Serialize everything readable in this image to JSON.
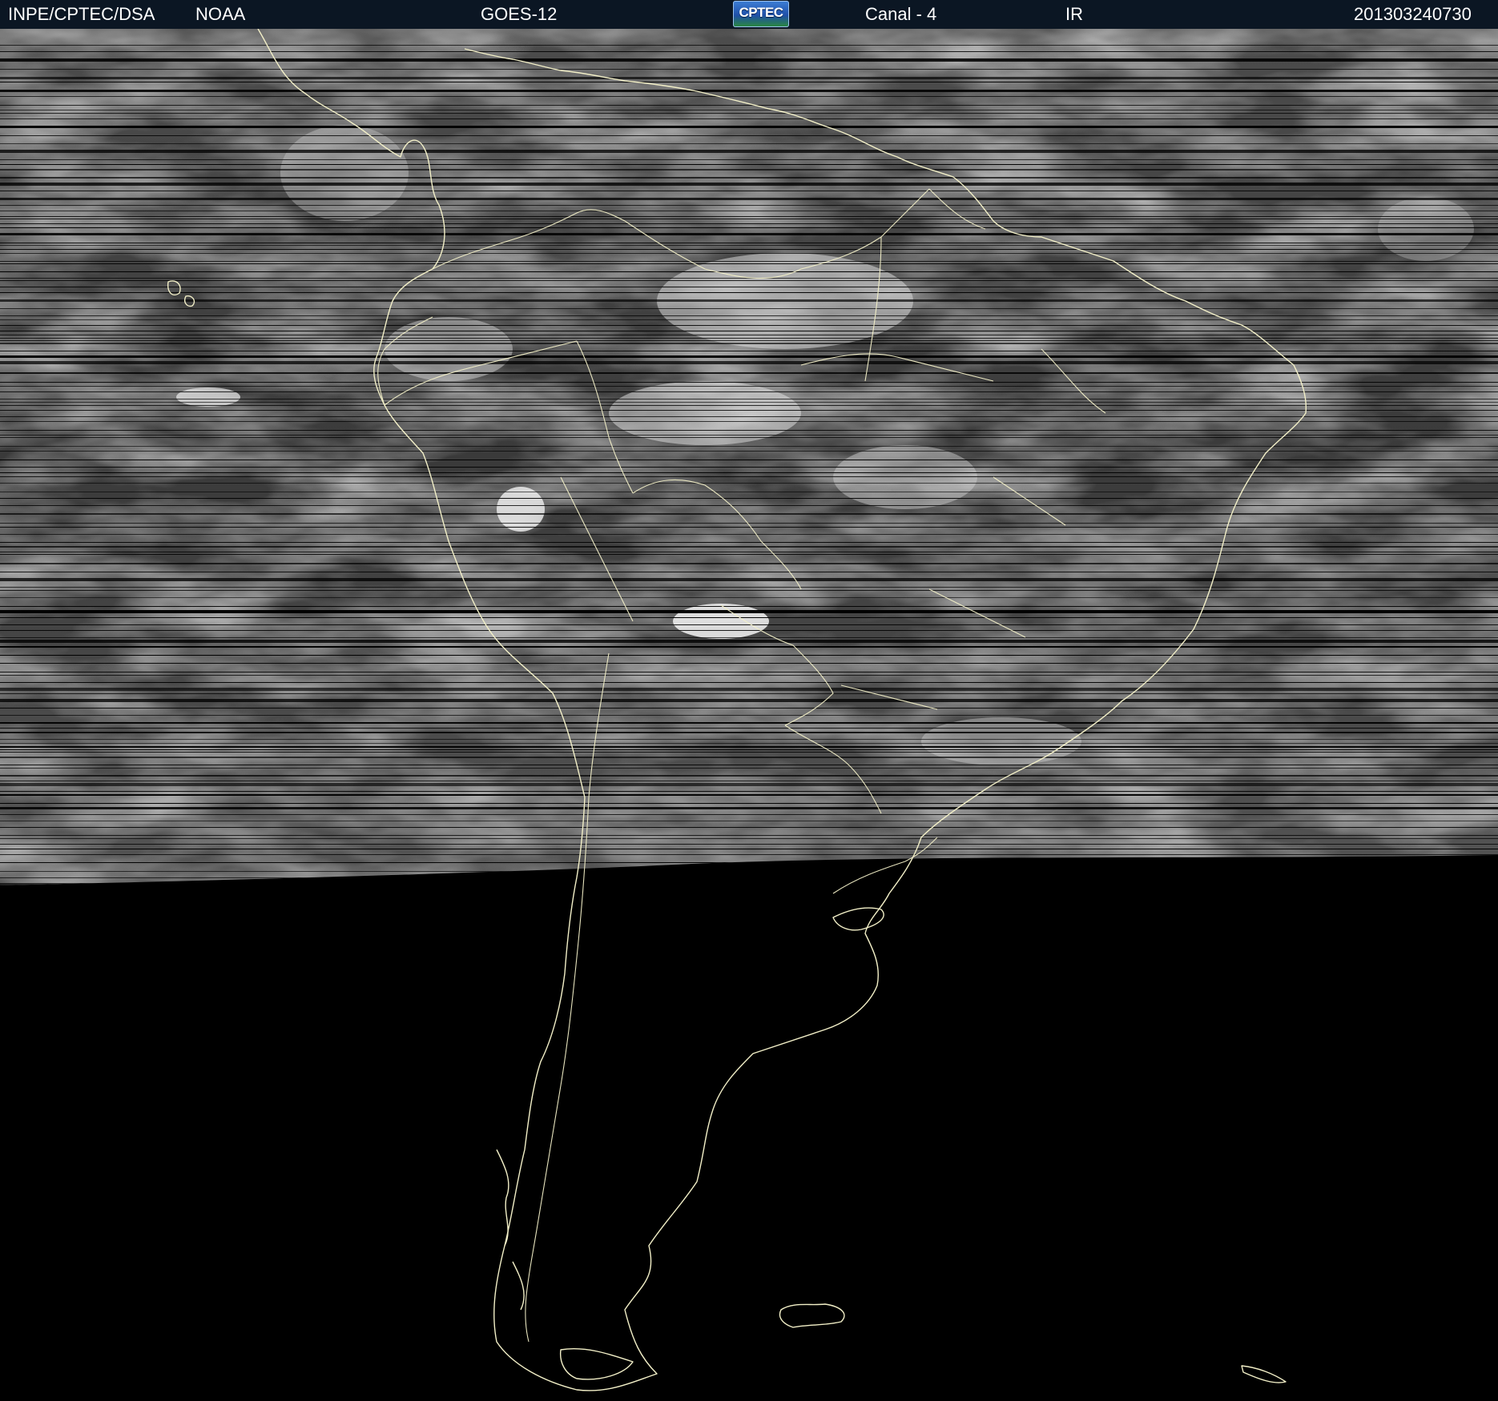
{
  "header": {
    "agency": "INPE/CPTEC/DSA",
    "source": "NOAA",
    "satellite": "GOES-12",
    "logo_text": "CPTEC",
    "channel": "Canal - 4",
    "band": "IR",
    "timestamp": "201303240730"
  },
  "colors": {
    "header_bg": "#0b1623",
    "header_text": "#ffffff",
    "coastline": "#f3f0c8",
    "night": "#000000",
    "cloud_gray": "#6a6a6a"
  },
  "map": {
    "region": "South America",
    "product": "infrared satellite imagery with country borders and coastlines",
    "artifact": "horizontal scan-line dropouts"
  }
}
